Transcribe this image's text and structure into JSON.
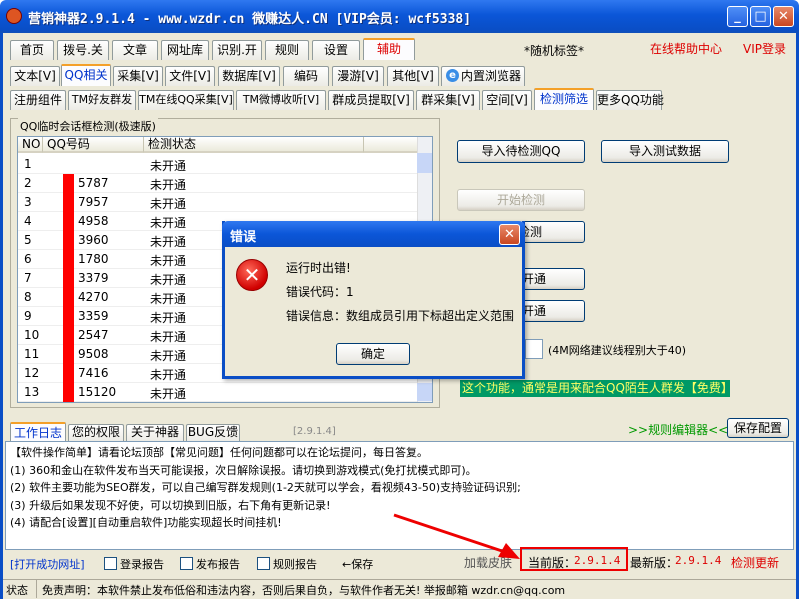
{
  "window": {
    "title": "营销神器2.9.1.4 - www.wzdr.cn 微赚达人.CN [VIP会员: wcf5338]"
  },
  "main_tabs": [
    "首页",
    "拨号.关",
    "文章",
    "网址库",
    "识别.开",
    "规则",
    "设置",
    "辅助"
  ],
  "random_tag": "*随机标签*",
  "help_link": "在线帮助中心",
  "vip_login": "VIP登录",
  "sub_tabs": [
    "文本[V]",
    "QQ相关",
    "采集[V]",
    "文件[V]",
    "数据库[V]",
    "编码",
    "漫游[V]",
    "其他[V]",
    "内置浏览器"
  ],
  "qq_tabs": [
    "注册组件",
    "TM好友群发",
    "TM在线QQ采集[V]",
    "TM微博收听[V]",
    "群成员提取[V]",
    "群采集[V]",
    "空间[V]",
    "检测筛选",
    "更多QQ功能"
  ],
  "group_title": "QQ临时会话框检测(极速版)",
  "table": {
    "headers": [
      "NO",
      "QQ号码",
      "检测状态"
    ],
    "rows": [
      {
        "no": "1",
        "qq": "",
        "status": "未开通"
      },
      {
        "no": "2",
        "qq": "5787",
        "status": "未开通"
      },
      {
        "no": "3",
        "qq": "7957",
        "status": "未开通"
      },
      {
        "no": "4",
        "qq": "4958",
        "status": "未开通"
      },
      {
        "no": "5",
        "qq": "3960",
        "status": "未开通"
      },
      {
        "no": "6",
        "qq": "1780",
        "status": "未开通"
      },
      {
        "no": "7",
        "qq": "3379",
        "status": "未开通"
      },
      {
        "no": "8",
        "qq": "4270",
        "status": "未开通"
      },
      {
        "no": "9",
        "qq": "3359",
        "status": "未开通"
      },
      {
        "no": "10",
        "qq": "2547",
        "status": "未开通"
      },
      {
        "no": "11",
        "qq": "9508",
        "status": "未开通"
      },
      {
        "no": "12",
        "qq": "7416",
        "status": "未开通"
      },
      {
        "no": "13",
        "qq": "15120",
        "status": "未开通"
      }
    ]
  },
  "buttons": {
    "import_check": "导入待检测QQ",
    "import_test": "导入测试数据",
    "start_check": "开始检测",
    "stop_partial": "检测",
    "open1": "开通",
    "open2": "开通",
    "save_config": "保存配置"
  },
  "thread_hint": "(4M网络建议线程别大于40)",
  "feature_note": "这个功能，通常是用来配合QQ陌生人群发【免费】",
  "dialog": {
    "title": "错误",
    "line1": "运行时出错!",
    "line2": "错误代码：1",
    "line3": "错误信息：数组成员引用下标超出定义范围",
    "ok": "确定"
  },
  "log_tabs": [
    "工作日志",
    "您的权限",
    "关于神器",
    "BUG反馈"
  ],
  "log_version": "[2.9.1.4]",
  "rule_editor": ">>规则编辑器<<",
  "log_lines": [
    "【软件操作简单】请看论坛顶部【常见问题】任何问题都可以在论坛提问，每日答复。",
    "(1) 360和金山在软件发布当天可能误报，次日解除误报。请切换到游戏模式(免打扰模式即可)。",
    "(2) 软件主要功能为SEO群发，可以自己编写群发规则(1-2天就可以学会，看视频43-50)支持验证码识别;",
    "(3) 升级后如果发现不好使，可以切换到旧版，右下角有更新记录!",
    "(4) 请配合[设置][自动重启软件]功能实现超长时间挂机!"
  ],
  "bottom": {
    "open_success": "[打开成功网址]",
    "login_report": "登录报告",
    "post_report": "发布报告",
    "rule_report": "规则报告",
    "save": "←保存",
    "load_skin": "加载皮肤",
    "current_label": "当前版：",
    "current_ver": "2.9.1.4",
    "latest_label": "最新版：",
    "latest_ver": "2.9.1.4",
    "check_update": "检测更新"
  },
  "status": {
    "label": "状态",
    "disclaimer": "免责声明：本软件禁止发布低俗和违法内容，否则后果自负，与软件作者无关! 举报邮箱 wzdr.cn@qq.com"
  },
  "colors": {
    "accent_red": "#dd0000",
    "note_bg": "#009966",
    "title_blue": "#0a4ec6"
  }
}
